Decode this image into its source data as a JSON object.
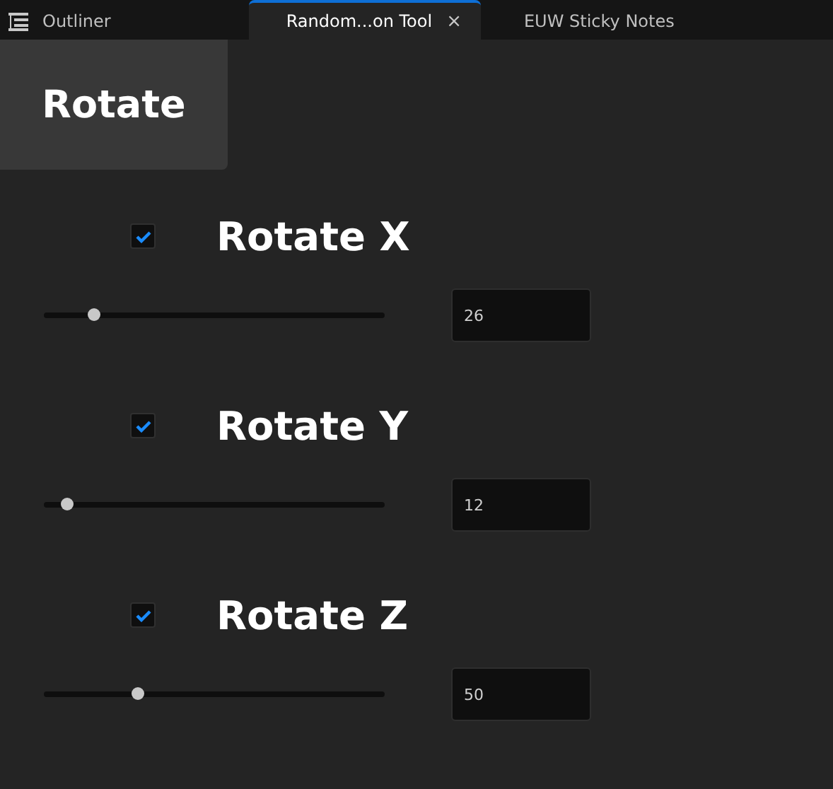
{
  "tabs": [
    {
      "label": "Outliner",
      "selected": false,
      "closable": false
    },
    {
      "label": "Random...on Tool",
      "selected": true,
      "closable": true
    },
    {
      "label": "EUW Sticky Notes",
      "selected": false,
      "closable": false
    }
  ],
  "tab_close": "×",
  "rotate_button": "Rotate",
  "axes": [
    {
      "label": "Rotate X",
      "checked": true,
      "level": 0.145,
      "value": "26"
    },
    {
      "label": "Rotate Y",
      "checked": true,
      "level": 0.066,
      "value": "12"
    },
    {
      "label": "Rotate Z",
      "checked": true,
      "level": 0.274,
      "value": "50"
    }
  ]
}
